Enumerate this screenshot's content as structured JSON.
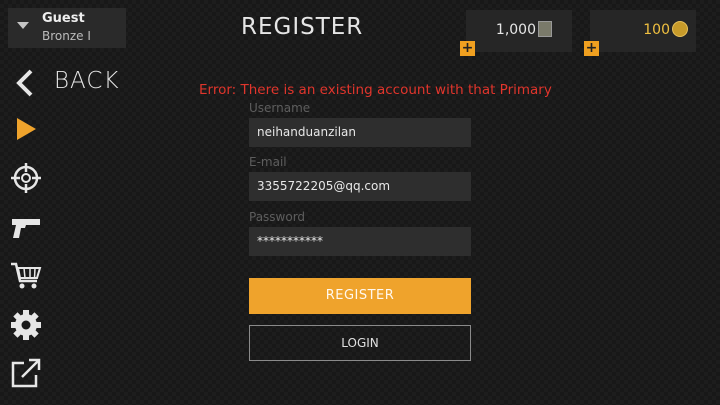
{
  "profile": {
    "name": "Guest",
    "rank": "Bronze I"
  },
  "nav": {
    "back_label": "BACK"
  },
  "page": {
    "title": "REGISTER"
  },
  "currency": {
    "cash": "1,000",
    "gold": "100",
    "cash_icon": "cash-icon",
    "gold_icon": "gold-coin-icon",
    "add_symbol": "+"
  },
  "error": {
    "message": "Error: There is an existing account with that Primary"
  },
  "form": {
    "username_label": "Username",
    "username_value": "neihanduanzilan",
    "email_label": "E-mail",
    "email_value": "3355722205@qq.com",
    "password_label": "Password",
    "password_value": "***********"
  },
  "buttons": {
    "register": "REGISTER",
    "login": "LOGIN"
  },
  "sidebar": {
    "items": [
      {
        "icon": "play-icon"
      },
      {
        "icon": "crosshair-icon"
      },
      {
        "icon": "pistol-icon"
      },
      {
        "icon": "cart-icon"
      },
      {
        "icon": "gear-icon"
      },
      {
        "icon": "external-link-icon"
      }
    ]
  },
  "colors": {
    "accent": "#efa32c",
    "error": "#e0352c",
    "gold": "#f0c040"
  }
}
